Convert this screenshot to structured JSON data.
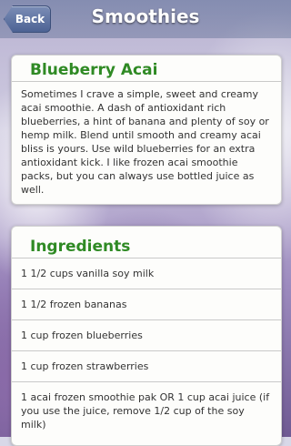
{
  "header": {
    "back_label": "Back",
    "title": "Smoothies"
  },
  "recipe": {
    "title": "Blueberry Acai",
    "description": "Sometimes I crave a simple, sweet and creamy acai smoothie. A dash of antioxidant rich blueberries, a hint of banana and plenty of soy or hemp milk. Blend until smooth and creamy acai bliss is yours. Use wild blueberries for an extra antioxidant kick. I like frozen acai smoothie packs, but you can always use bottled juice as well."
  },
  "ingredients": {
    "title": "Ingredients",
    "items": [
      "1 1/2 cups vanilla soy milk",
      "1 1/2 frozen bananas",
      "1 cup frozen blueberries",
      "1 cup frozen strawberries",
      "1 acai frozen smoothie pak OR 1 cup acai juice (if you use the juice, remove 1/2 cup of the soy milk)"
    ]
  },
  "colors": {
    "title_green": "#2f8a24",
    "header_blue": "#4d6394"
  }
}
